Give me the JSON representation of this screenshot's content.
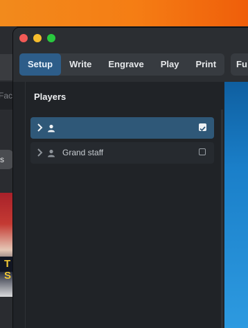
{
  "background": {
    "search_fragment": "Face",
    "pill_fragment": "s",
    "photo_text": "T S"
  },
  "window": {
    "mode_tabs": [
      {
        "label": "Setup",
        "active": true
      },
      {
        "label": "Write",
        "active": false
      },
      {
        "label": "Engrave",
        "active": false
      },
      {
        "label": "Play",
        "active": false
      },
      {
        "label": "Print",
        "active": false
      }
    ],
    "extra_button": "Fu",
    "players_panel": {
      "title": "Players",
      "rows": [
        {
          "label": "",
          "selected": true,
          "checked": true
        },
        {
          "label": "Grand staff",
          "selected": false,
          "checked": false
        }
      ]
    }
  },
  "colors": {
    "accent": "#2d5d89",
    "selected_row": "#2f5878",
    "desktop_orange": "#f57d14"
  }
}
